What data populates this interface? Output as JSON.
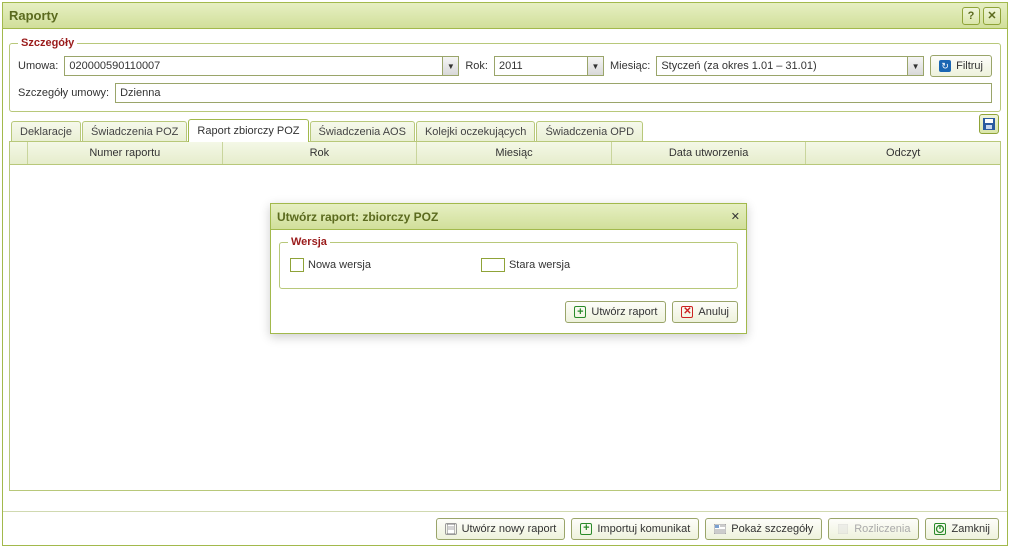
{
  "window": {
    "title": "Raporty"
  },
  "details": {
    "legend": "Szczegóły",
    "umowa_label": "Umowa:",
    "umowa_value": "020000590110007",
    "rok_label": "Rok:",
    "rok_value": "2011",
    "miesiac_label": "Miesiąc:",
    "miesiac_value": "Styczeń (za okres 1.01 – 31.01)",
    "filtruj_label": "Filtruj",
    "szczegoly_umowy_label": "Szczegóły umowy:",
    "szczegoly_umowy_value": "Dzienna"
  },
  "tabs": [
    {
      "label": "Deklaracje",
      "active": false
    },
    {
      "label": "Świadczenia POZ",
      "active": false
    },
    {
      "label": "Raport zbiorczy POZ",
      "active": true
    },
    {
      "label": "Świadczenia AOS",
      "active": false
    },
    {
      "label": "Kolejki oczekujących",
      "active": false
    },
    {
      "label": "Świadczenia OPD",
      "active": false
    }
  ],
  "grid": {
    "columns": [
      "Numer raportu",
      "Rok",
      "Miesiąc",
      "Data utworzenia",
      "Odczyt"
    ],
    "rows": []
  },
  "modal": {
    "title": "Utwórz raport: zbiorczy POZ",
    "wersja_legend": "Wersja",
    "nowa_label": "Nowa wersja",
    "stara_label": "Stara wersja",
    "selected": "stara",
    "create_label": "Utwórz raport",
    "cancel_label": "Anuluj"
  },
  "footer": {
    "nowy_raport": "Utwórz nowy raport",
    "importuj": "Importuj komunikat",
    "pokaz": "Pokaż szczegóły",
    "rozliczenia": "Rozliczenia",
    "zamknij": "Zamknij"
  }
}
